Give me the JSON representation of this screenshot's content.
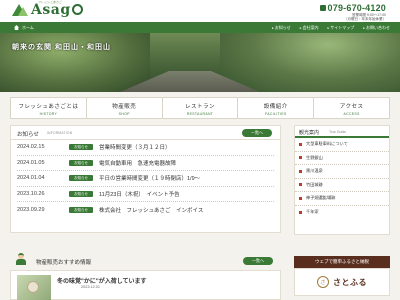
{
  "header": {
    "logo_text_pre": "Asag",
    "logo_sub": "フレッシュあさご",
    "tel": "079-670-4120",
    "hours_line1": "営業時間 9:00～17:00",
    "hours_line2": "（月曜日・年末年始休業）"
  },
  "topnav": {
    "home": "ホーム",
    "links": [
      "お知らせ",
      "会社案内",
      "サイトマップ",
      "お問い合わせ"
    ]
  },
  "hero": {
    "title": "朝来の玄関 和田山・和田山"
  },
  "mainnav": [
    {
      "jp": "フレッシュあさごとは",
      "en": "HISTORY"
    },
    {
      "jp": "物産販売",
      "en": "SHOP"
    },
    {
      "jp": "レストラン",
      "en": "RESTAURANT"
    },
    {
      "jp": "設備紹介",
      "en": "FACILITIES"
    },
    {
      "jp": "アクセス",
      "en": "ACCESS"
    }
  ],
  "news": {
    "title": "お知らせ",
    "subtitle": "INFORMATION",
    "list_button": "一覧へ",
    "items": [
      {
        "date": "2024.02.15",
        "badge": "お知らせ",
        "text": "営業時間変更（３月１２日）"
      },
      {
        "date": "2024.01.05",
        "badge": "お知らせ",
        "text": "電気自動車用　急速充電器故障"
      },
      {
        "date": "2024.01.04",
        "badge": "お知らせ",
        "text": "平日の営業時間変更（１９時閉店）1/9～"
      },
      {
        "date": "2023.10.26",
        "badge": "お知らせ",
        "text": "11月23日（木祝）　イベント予告"
      },
      {
        "date": "2023.09.29",
        "badge": "お知らせ",
        "text": "株式会社　フレッシュあさご　インボイス"
      }
    ]
  },
  "products": {
    "title": "物産販売おすすめ情報",
    "list_button": "一覧へ",
    "item_title": "冬の味覚\"かに\"が入荷しています",
    "item_date": "2023.12.01"
  },
  "sidebar": {
    "title": "観光案内",
    "subtitle": "Tour Guide",
    "items": [
      "大型車駐車料について",
      "生野銀山",
      "黒川温泉",
      "竹田城跡",
      "神子畑選鉱場跡",
      "千年家"
    ]
  },
  "furusato": {
    "banner": "ウェブで簡単ふるさと納税",
    "logo_char": "さ",
    "name": "さとふる"
  },
  "colors": {
    "accent_green": "#3a7a36",
    "furusato_brown": "#5a2e1e",
    "bullet_red": "#c0392b"
  }
}
